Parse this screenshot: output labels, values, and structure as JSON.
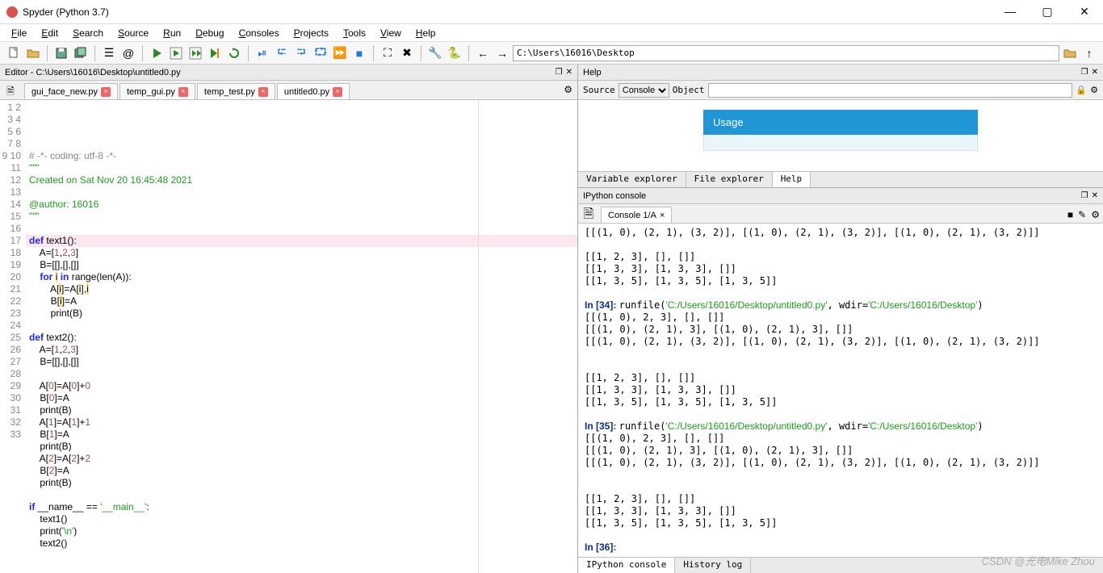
{
  "window": {
    "title": "Spyder (Python 3.7)"
  },
  "menu": [
    "File",
    "Edit",
    "Search",
    "Source",
    "Run",
    "Debug",
    "Consoles",
    "Projects",
    "Tools",
    "View",
    "Help"
  ],
  "address": "C:\\Users\\16016\\Desktop",
  "editor": {
    "title": "Editor - C:\\Users\\16016\\Desktop\\untitled0.py",
    "tabs": [
      {
        "label": "gui_face_new.py",
        "closable": true,
        "active": false
      },
      {
        "label": "temp_gui.py",
        "closable": true,
        "active": false
      },
      {
        "label": "temp_test.py",
        "closable": true,
        "active": false
      },
      {
        "label": "untitled0.py",
        "closable": true,
        "active": true
      }
    ],
    "current_line": 12,
    "lines": [
      {
        "n": 1,
        "seg": [
          {
            "c": "c-comment",
            "t": "# -*- coding: utf-8 -*-"
          }
        ]
      },
      {
        "n": 2,
        "seg": [
          {
            "c": "c-str",
            "t": "\"\"\""
          }
        ]
      },
      {
        "n": 3,
        "seg": [
          {
            "c": "c-str",
            "t": "Created on Sat Nov 20 16:45:48 2021"
          }
        ]
      },
      {
        "n": 4,
        "seg": []
      },
      {
        "n": 5,
        "seg": [
          {
            "c": "c-str",
            "t": "@author: 16016"
          }
        ]
      },
      {
        "n": 6,
        "seg": [
          {
            "c": "c-str",
            "t": "\"\"\""
          }
        ]
      },
      {
        "n": 7,
        "seg": []
      },
      {
        "n": 8,
        "seg": [
          {
            "c": "c-key",
            "t": "def"
          },
          {
            "c": "",
            "t": " text1():"
          }
        ]
      },
      {
        "n": 9,
        "seg": [
          {
            "c": "",
            "t": "    A=["
          },
          {
            "c": "c-num",
            "t": "1"
          },
          {
            "c": "",
            "t": ","
          },
          {
            "c": "c-num",
            "t": "2"
          },
          {
            "c": "",
            "t": ","
          },
          {
            "c": "c-num",
            "t": "3"
          },
          {
            "c": "",
            "t": "]"
          }
        ]
      },
      {
        "n": 10,
        "seg": [
          {
            "c": "",
            "t": "    B=[[],[],[]]"
          }
        ]
      },
      {
        "n": 11,
        "seg": [
          {
            "c": "",
            "t": "    "
          },
          {
            "c": "c-key",
            "t": "for"
          },
          {
            "c": "",
            "t": " "
          },
          {
            "c": "c-hl",
            "t": "i"
          },
          {
            "c": "",
            "t": " "
          },
          {
            "c": "c-key",
            "t": "in"
          },
          {
            "c": "",
            "t": " range(len(A)):"
          }
        ]
      },
      {
        "n": 12,
        "seg": [
          {
            "c": "",
            "t": "        A["
          },
          {
            "c": "c-hl",
            "t": "i"
          },
          {
            "c": "",
            "t": "]=A["
          },
          {
            "c": "c-hl",
            "t": "i"
          },
          {
            "c": "",
            "t": "],"
          },
          {
            "c": "c-hl",
            "t": "i"
          }
        ]
      },
      {
        "n": 13,
        "seg": [
          {
            "c": "",
            "t": "        B["
          },
          {
            "c": "c-hl",
            "t": "i"
          },
          {
            "c": "",
            "t": "]=A"
          }
        ]
      },
      {
        "n": 14,
        "seg": [
          {
            "c": "",
            "t": "        print(B)"
          }
        ]
      },
      {
        "n": 15,
        "seg": []
      },
      {
        "n": 16,
        "seg": [
          {
            "c": "c-key",
            "t": "def"
          },
          {
            "c": "",
            "t": " text2():"
          }
        ]
      },
      {
        "n": 17,
        "seg": [
          {
            "c": "",
            "t": "    A=["
          },
          {
            "c": "c-num",
            "t": "1"
          },
          {
            "c": "",
            "t": ","
          },
          {
            "c": "c-num",
            "t": "2"
          },
          {
            "c": "",
            "t": ","
          },
          {
            "c": "c-num",
            "t": "3"
          },
          {
            "c": "",
            "t": "]"
          }
        ]
      },
      {
        "n": 18,
        "seg": [
          {
            "c": "",
            "t": "    B=[[],[],[]]"
          }
        ]
      },
      {
        "n": 19,
        "seg": []
      },
      {
        "n": 20,
        "seg": [
          {
            "c": "",
            "t": "    A["
          },
          {
            "c": "c-num",
            "t": "0"
          },
          {
            "c": "",
            "t": "]=A["
          },
          {
            "c": "c-num",
            "t": "0"
          },
          {
            "c": "",
            "t": "]+"
          },
          {
            "c": "c-num",
            "t": "0"
          }
        ]
      },
      {
        "n": 21,
        "seg": [
          {
            "c": "",
            "t": "    B["
          },
          {
            "c": "c-num",
            "t": "0"
          },
          {
            "c": "",
            "t": "]=A"
          }
        ]
      },
      {
        "n": 22,
        "seg": [
          {
            "c": "",
            "t": "    print(B)"
          }
        ]
      },
      {
        "n": 23,
        "seg": [
          {
            "c": "",
            "t": "    A["
          },
          {
            "c": "c-num",
            "t": "1"
          },
          {
            "c": "",
            "t": "]=A["
          },
          {
            "c": "c-num",
            "t": "1"
          },
          {
            "c": "",
            "t": "]+"
          },
          {
            "c": "c-num",
            "t": "1"
          }
        ]
      },
      {
        "n": 24,
        "seg": [
          {
            "c": "",
            "t": "    B["
          },
          {
            "c": "c-num",
            "t": "1"
          },
          {
            "c": "",
            "t": "]=A"
          }
        ]
      },
      {
        "n": 25,
        "seg": [
          {
            "c": "",
            "t": "    print(B)"
          }
        ]
      },
      {
        "n": 26,
        "seg": [
          {
            "c": "",
            "t": "    A["
          },
          {
            "c": "c-num",
            "t": "2"
          },
          {
            "c": "",
            "t": "]=A["
          },
          {
            "c": "c-num",
            "t": "2"
          },
          {
            "c": "",
            "t": "]+"
          },
          {
            "c": "c-num",
            "t": "2"
          }
        ]
      },
      {
        "n": 27,
        "seg": [
          {
            "c": "",
            "t": "    B["
          },
          {
            "c": "c-num",
            "t": "2"
          },
          {
            "c": "",
            "t": "]=A"
          }
        ]
      },
      {
        "n": 28,
        "seg": [
          {
            "c": "",
            "t": "    print(B)"
          }
        ]
      },
      {
        "n": 29,
        "seg": []
      },
      {
        "n": 30,
        "seg": [
          {
            "c": "c-key",
            "t": "if"
          },
          {
            "c": "",
            "t": " __name__ == "
          },
          {
            "c": "c-str",
            "t": "'__main__'"
          },
          {
            "c": "",
            "t": ":"
          }
        ]
      },
      {
        "n": 31,
        "seg": [
          {
            "c": "",
            "t": "    text1()"
          }
        ]
      },
      {
        "n": 32,
        "seg": [
          {
            "c": "",
            "t": "    print("
          },
          {
            "c": "c-str",
            "t": "'\\n'"
          },
          {
            "c": "",
            "t": ")"
          }
        ]
      },
      {
        "n": 33,
        "seg": [
          {
            "c": "",
            "t": "    text2()"
          }
        ]
      }
    ]
  },
  "help": {
    "title": "Help",
    "source_label": "Source",
    "source_value": "Console",
    "object_label": "Object",
    "object_value": "",
    "usage_label": "Usage",
    "tabs": [
      "Variable explorer",
      "File explorer",
      "Help"
    ],
    "active_tab": "Help"
  },
  "console": {
    "title": "IPython console",
    "tab": "Console 1/A",
    "bottom_tabs": [
      "IPython console",
      "History log"
    ],
    "active_bottom": "IPython console",
    "lines": [
      {
        "seg": [
          {
            "c": "",
            "t": "[[(1, 0), (2, 1), (3, 2)], [(1, 0), (2, 1), (3, 2)], [(1, 0), (2, 1), (3, 2)]]"
          }
        ]
      },
      {
        "seg": []
      },
      {
        "seg": [
          {
            "c": "",
            "t": "[[1, 2, 3], [], []]"
          }
        ]
      },
      {
        "seg": [
          {
            "c": "",
            "t": "[[1, 3, 3], [1, 3, 3], []]"
          }
        ]
      },
      {
        "seg": [
          {
            "c": "",
            "t": "[[1, 3, 5], [1, 3, 5], [1, 3, 5]]"
          }
        ]
      },
      {
        "seg": []
      },
      {
        "seg": [
          {
            "c": "c-in",
            "t": "In [34]: "
          },
          {
            "c": "",
            "t": "runfile("
          },
          {
            "c": "c-path",
            "t": "'C:/Users/16016/Desktop/untitled0.py'"
          },
          {
            "c": "",
            "t": ", wdir="
          },
          {
            "c": "c-path",
            "t": "'C:/Users/16016/Desktop'"
          },
          {
            "c": "",
            "t": ")"
          }
        ]
      },
      {
        "seg": [
          {
            "c": "",
            "t": "[[(1, 0), 2, 3], [], []]"
          }
        ]
      },
      {
        "seg": [
          {
            "c": "",
            "t": "[[(1, 0), (2, 1), 3], [(1, 0), (2, 1), 3], []]"
          }
        ]
      },
      {
        "seg": [
          {
            "c": "",
            "t": "[[(1, 0), (2, 1), (3, 2)], [(1, 0), (2, 1), (3, 2)], [(1, 0), (2, 1), (3, 2)]]"
          }
        ]
      },
      {
        "seg": []
      },
      {
        "seg": []
      },
      {
        "seg": [
          {
            "c": "",
            "t": "[[1, 2, 3], [], []]"
          }
        ]
      },
      {
        "seg": [
          {
            "c": "",
            "t": "[[1, 3, 3], [1, 3, 3], []]"
          }
        ]
      },
      {
        "seg": [
          {
            "c": "",
            "t": "[[1, 3, 5], [1, 3, 5], [1, 3, 5]]"
          }
        ]
      },
      {
        "seg": []
      },
      {
        "seg": [
          {
            "c": "c-in",
            "t": "In [35]: "
          },
          {
            "c": "",
            "t": "runfile("
          },
          {
            "c": "c-path",
            "t": "'C:/Users/16016/Desktop/untitled0.py'"
          },
          {
            "c": "",
            "t": ", wdir="
          },
          {
            "c": "c-path",
            "t": "'C:/Users/16016/Desktop'"
          },
          {
            "c": "",
            "t": ")"
          }
        ]
      },
      {
        "seg": [
          {
            "c": "",
            "t": "[[(1, 0), 2, 3], [], []]"
          }
        ]
      },
      {
        "seg": [
          {
            "c": "",
            "t": "[[(1, 0), (2, 1), 3], [(1, 0), (2, 1), 3], []]"
          }
        ]
      },
      {
        "seg": [
          {
            "c": "",
            "t": "[[(1, 0), (2, 1), (3, 2)], [(1, 0), (2, 1), (3, 2)], [(1, 0), (2, 1), (3, 2)]]"
          }
        ]
      },
      {
        "seg": []
      },
      {
        "seg": []
      },
      {
        "seg": [
          {
            "c": "",
            "t": "[[1, 2, 3], [], []]"
          }
        ]
      },
      {
        "seg": [
          {
            "c": "",
            "t": "[[1, 3, 3], [1, 3, 3], []]"
          }
        ]
      },
      {
        "seg": [
          {
            "c": "",
            "t": "[[1, 3, 5], [1, 3, 5], [1, 3, 5]]"
          }
        ]
      },
      {
        "seg": []
      },
      {
        "seg": [
          {
            "c": "c-in",
            "t": "In [36]: "
          }
        ]
      }
    ]
  },
  "watermark": "CSDN @光电Mike Zhou"
}
